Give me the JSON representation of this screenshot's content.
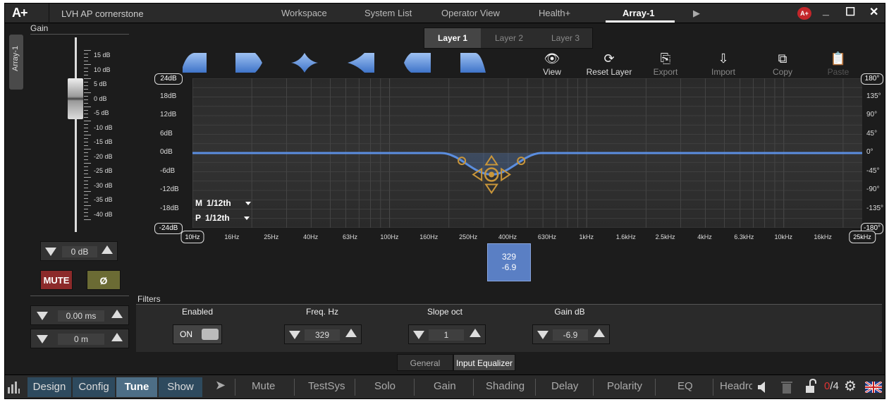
{
  "app": {
    "logo": "A+",
    "project": "LVH AP cornerstone",
    "badge": "A+",
    "nav_tabs": [
      {
        "label": "Workspace",
        "active": false
      },
      {
        "label": "System List",
        "active": false
      },
      {
        "label": "Operator View",
        "active": false
      },
      {
        "label": "Health+",
        "active": false
      },
      {
        "label": "Array-1",
        "active": true
      }
    ],
    "window_buttons": [
      "_",
      "☐",
      "✕"
    ]
  },
  "side_tab": "Array-1",
  "gain": {
    "label": "Gain",
    "scale": [
      "15 dB",
      "10 dB",
      "5 dB",
      "0 dB",
      "-5 dB",
      "-10 dB",
      "-15 dB",
      "-20 dB",
      "-25 dB",
      "-30 dB",
      "-35 dB",
      "-40 dB"
    ],
    "value": "0 dB",
    "level_db": 0
  },
  "buttons": {
    "mute": "MUTE",
    "phase": "Ø"
  },
  "delay": {
    "time": "0.00 ms",
    "distance": "0 m"
  },
  "layers": [
    {
      "label": "Layer 1",
      "active": true
    },
    {
      "label": "Layer 2",
      "active": false
    },
    {
      "label": "Layer 3",
      "active": false
    }
  ],
  "filter_shapes": [
    "low-shelf-icon",
    "high-cut-icon",
    "peak-icon",
    "notch-icon",
    "band-pass-icon",
    "high-shelf-icon"
  ],
  "tools": [
    {
      "label": "View",
      "icon": "eye-icon",
      "state": "normal"
    },
    {
      "label": "Reset Layer",
      "icon": "refresh-icon",
      "state": "normal"
    },
    {
      "label": "Export",
      "icon": "export-icon",
      "state": "dim"
    },
    {
      "label": "Import",
      "icon": "import-icon",
      "state": "dim"
    },
    {
      "label": "Copy",
      "icon": "copy-icon",
      "state": "dim"
    },
    {
      "label": "Paste",
      "icon": "paste-icon",
      "state": "disabled"
    }
  ],
  "graph": {
    "db_labels": [
      "24dB",
      "18dB",
      "12dB",
      "6dB",
      "0dB",
      "-6dB",
      "-12dB",
      "-18dB",
      "-24dB"
    ],
    "deg_labels": [
      "180°",
      "135°",
      "90°",
      "45°",
      "0°",
      "-45°",
      "-90°",
      "-135°",
      "-180°"
    ],
    "freq_labels": [
      "10Hz",
      "16Hz",
      "25Hz",
      "40Hz",
      "63Hz",
      "100Hz",
      "160Hz",
      "250Hz",
      "400Hz",
      "630Hz",
      "1kHz",
      "1.6kHz",
      "2.5kHz",
      "4kHz",
      "6.3kHz",
      "10kHz",
      "16kHz",
      "25kHz"
    ],
    "resolution": [
      {
        "key": "M",
        "value": "1/12th"
      },
      {
        "key": "P",
        "value": "1/12th"
      }
    ],
    "curve_color": "#5b8ee0",
    "handle_color": "#c9963a",
    "eq_point": {
      "freq_hz": 329,
      "gain_db": -6.9,
      "slope_oct": 1
    }
  },
  "tooltip": {
    "freq": "329",
    "gain": "-6.9"
  },
  "filters": {
    "title": "Filters",
    "enabled_label": "Enabled",
    "enabled_value": "ON",
    "freq_label": "Freq. Hz",
    "freq_value": "329",
    "slope_label": "Slope oct",
    "slope_value": "1",
    "gain_label": "Gain dB",
    "gain_value": "-6.9"
  },
  "subtabs": [
    {
      "label": "General",
      "active": false
    },
    {
      "label": "Input Equalizer",
      "active": true
    }
  ],
  "bottom": {
    "modes": [
      {
        "label": "Design",
        "active": false
      },
      {
        "label": "Config",
        "active": false
      },
      {
        "label": "Tune",
        "active": true
      },
      {
        "label": "Show",
        "active": false
      }
    ],
    "tools": [
      "Mute",
      "TestSys",
      "Solo",
      "Gain",
      "Shading",
      "Delay",
      "Polarity",
      "EQ",
      "Headrc"
    ],
    "count_zero": "0",
    "count_total": "/4"
  }
}
